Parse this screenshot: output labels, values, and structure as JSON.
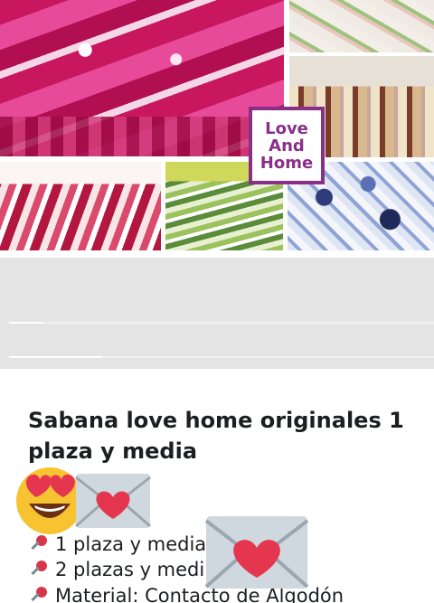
{
  "photo": {
    "alt_semantic": "bed-sheet-collage",
    "brand_lines": [
      "Love",
      "And",
      "Home"
    ],
    "brand_color": "#8a2f87"
  },
  "gallery": {
    "pager_progress": [
      0.08,
      0.22
    ]
  },
  "product": {
    "title": "Sabana love home originales 1 plaza y media",
    "price_suffix": ")",
    "features": [
      "1 plaza y media",
      "2 plazas y medi",
      "Material: Contacto de Algodón"
    ]
  },
  "icons": {
    "pin": "pushpin-icon",
    "envelope": "love-letter-icon",
    "emoji": "heart-eyes-emoji"
  }
}
